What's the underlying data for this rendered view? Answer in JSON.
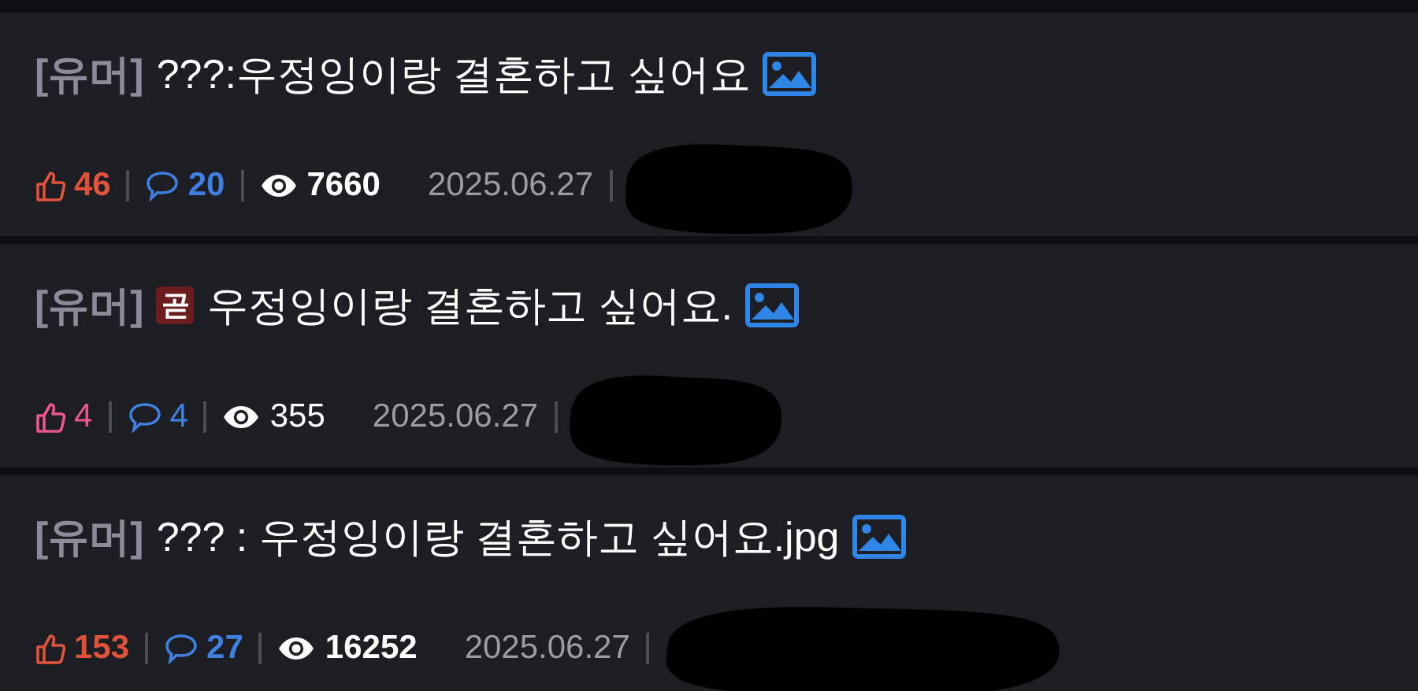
{
  "posts": [
    {
      "category": "[유머]",
      "title": "???:우정잉이랑 결혼하고 싶어요",
      "hot": true,
      "likes": "46",
      "comments": "20",
      "views": "7660",
      "date": "2025.06.27"
    },
    {
      "category": "[유머]",
      "badge": "곧",
      "title": "우정잉이랑 결혼하고 싶어요.",
      "hot": false,
      "likes": "4",
      "comments": "4",
      "views": "355",
      "date": "2025.06.27"
    },
    {
      "category": "[유머]",
      "title": "??? : 우정잉이랑 결혼하고 싶어요.jpg",
      "hot": true,
      "likes": "153",
      "comments": "27",
      "views": "16252",
      "date": "2025.06.27"
    }
  ]
}
